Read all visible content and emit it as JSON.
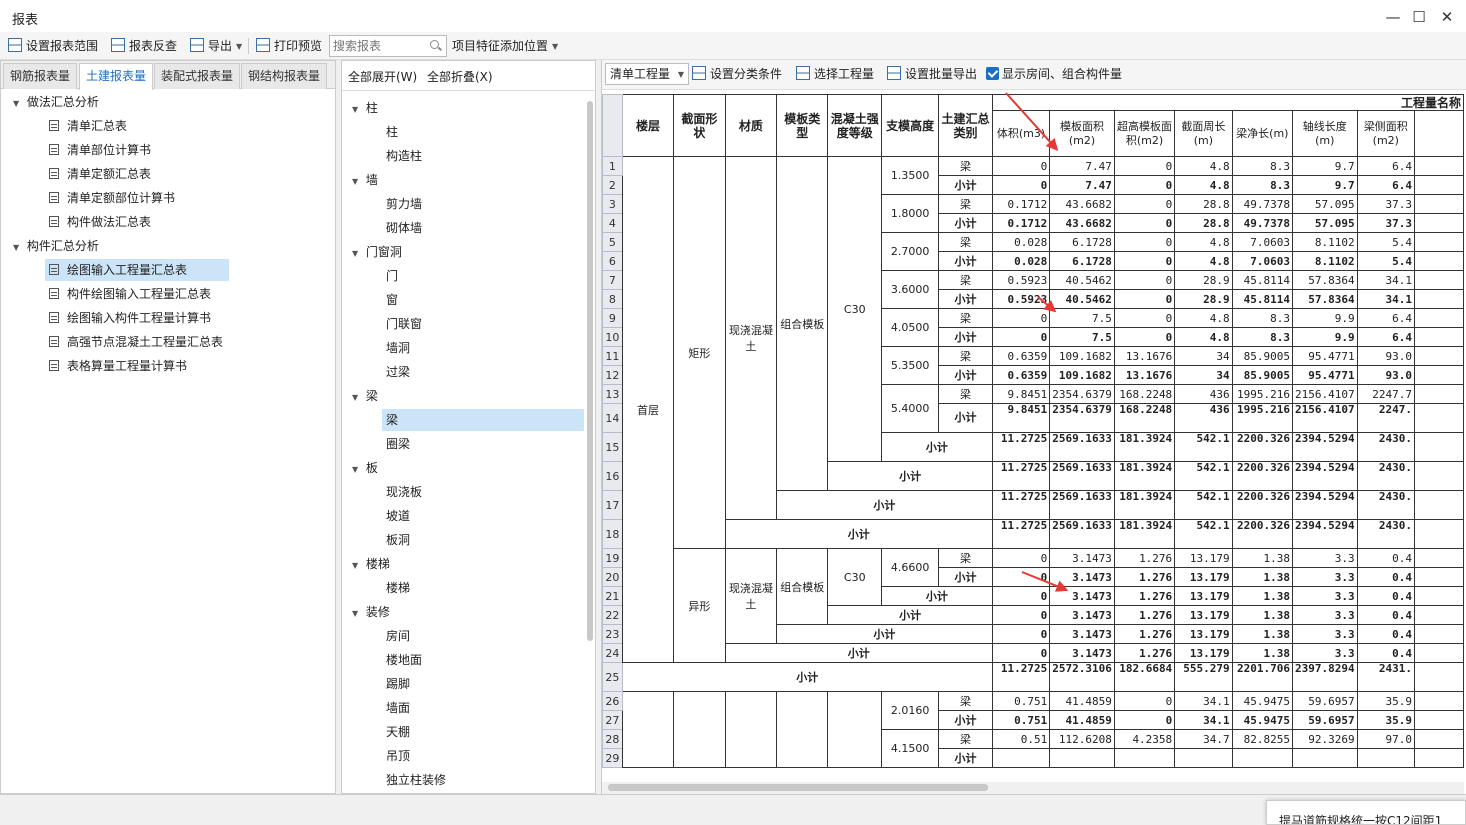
{
  "window": {
    "title": "报表",
    "min": "—",
    "max": "☐",
    "close": "✕"
  },
  "toolbar": {
    "set_range": "设置报表范围",
    "reverse": "报表反查",
    "export": "导出",
    "print_preview": "打印预览",
    "search_placeholder": "搜索报表",
    "feature_position": "项目特征添加位置"
  },
  "tabs": [
    "钢筋报表量",
    "土建报表量",
    "装配式报表量",
    "钢结构报表量"
  ],
  "active_tab": "土建报表量",
  "left_tree": [
    {
      "label": "做法汇总分析",
      "level": 0
    },
    {
      "label": "清单汇总表",
      "level": 1
    },
    {
      "label": "清单部位计算书",
      "level": 1
    },
    {
      "label": "清单定额汇总表",
      "level": 1
    },
    {
      "label": "清单定额部位计算书",
      "level": 1
    },
    {
      "label": "构件做法汇总表",
      "level": 1
    },
    {
      "label": "构件汇总分析",
      "level": 0
    },
    {
      "label": "绘图输入工程量汇总表",
      "level": 1,
      "selected": true
    },
    {
      "label": "构件绘图输入工程量汇总表",
      "level": 1
    },
    {
      "label": "绘图输入构件工程量计算书",
      "level": 1
    },
    {
      "label": "高强节点混凝土工程量汇总表",
      "level": 1
    },
    {
      "label": "表格算量工程量计算书",
      "level": 1
    }
  ],
  "mid_head": {
    "expand_all": "全部展开(W)",
    "collapse_all": "全部折叠(X)"
  },
  "mid_tree": [
    {
      "label": "柱",
      "level": 0
    },
    {
      "label": "柱",
      "level": 1
    },
    {
      "label": "构造柱",
      "level": 1
    },
    {
      "label": "墙",
      "level": 0
    },
    {
      "label": "剪力墙",
      "level": 1
    },
    {
      "label": "砌体墙",
      "level": 1
    },
    {
      "label": "门窗洞",
      "level": 0
    },
    {
      "label": "门",
      "level": 1
    },
    {
      "label": "窗",
      "level": 1
    },
    {
      "label": "门联窗",
      "level": 1
    },
    {
      "label": "墙洞",
      "level": 1
    },
    {
      "label": "过梁",
      "level": 1
    },
    {
      "label": "梁",
      "level": 0
    },
    {
      "label": "梁",
      "level": 1,
      "selected": true
    },
    {
      "label": "圈梁",
      "level": 1
    },
    {
      "label": "板",
      "level": 0
    },
    {
      "label": "现浇板",
      "level": 1
    },
    {
      "label": "坡道",
      "level": 1
    },
    {
      "label": "板洞",
      "level": 1
    },
    {
      "label": "楼梯",
      "level": 0
    },
    {
      "label": "楼梯",
      "level": 1
    },
    {
      "label": "装修",
      "level": 0
    },
    {
      "label": "房间",
      "level": 1
    },
    {
      "label": "楼地面",
      "level": 1
    },
    {
      "label": "踢脚",
      "level": 1
    },
    {
      "label": "墙面",
      "level": 1
    },
    {
      "label": "天棚",
      "level": 1
    },
    {
      "label": "吊顶",
      "level": 1
    },
    {
      "label": "独立柱装修",
      "level": 1
    }
  ],
  "right_toolbar": {
    "combo": "清单工程量",
    "classify": "设置分类条件",
    "select_qty": "选择工程量",
    "batch_export": "设置批量导出",
    "show_rooms": "显示房间、组合构件量"
  },
  "grid": {
    "group_header": "工程量名称",
    "headers": [
      "楼层",
      "截面形状",
      "材质",
      "模板类型",
      "混凝土强度等级",
      "支模高度",
      "土建汇总类别"
    ],
    "qty_headers": [
      "体积(m3)",
      "模板面积(m2)",
      "超高模板面积(m2)",
      "截面周长(m)",
      "梁净长(m)",
      "轴线长度(m)",
      "梁侧面积(m2)"
    ],
    "floor": "首层",
    "shape_rect": "矩形",
    "shape_irregular": "异形",
    "material": "现浇混凝土",
    "formwork": "组合模板",
    "grade": "C30",
    "beam": "梁",
    "subtotal": "小计",
    "heights": [
      "1.3500",
      "1.8000",
      "2.7000",
      "3.6000",
      "4.0500",
      "5.3500",
      "5.4000",
      "4.6600",
      "2.0160",
      "4.1500"
    ],
    "rows": [
      [
        "0",
        "7.47",
        "0",
        "4.8",
        "8.3",
        "9.7",
        "6.4"
      ],
      [
        "0",
        "7.47",
        "0",
        "4.8",
        "8.3",
        "9.7",
        "6.4"
      ],
      [
        "0.1712",
        "43.6682",
        "0",
        "28.8",
        "49.7378",
        "57.095",
        "37.3"
      ],
      [
        "0.1712",
        "43.6682",
        "0",
        "28.8",
        "49.7378",
        "57.095",
        "37.3"
      ],
      [
        "0.028",
        "6.1728",
        "0",
        "4.8",
        "7.0603",
        "8.1102",
        "5.4"
      ],
      [
        "0.028",
        "6.1728",
        "0",
        "4.8",
        "7.0603",
        "8.1102",
        "5.4"
      ],
      [
        "0.5923",
        "40.5462",
        "0",
        "28.9",
        "45.8114",
        "57.8364",
        "34.1"
      ],
      [
        "0.5923",
        "40.5462",
        "0",
        "28.9",
        "45.8114",
        "57.8364",
        "34.1"
      ],
      [
        "0",
        "7.5",
        "0",
        "4.8",
        "8.3",
        "9.9",
        "6.4"
      ],
      [
        "0",
        "7.5",
        "0",
        "4.8",
        "8.3",
        "9.9",
        "6.4"
      ],
      [
        "0.6359",
        "109.1682",
        "13.1676",
        "34",
        "85.9005",
        "95.4771",
        "93.0"
      ],
      [
        "0.6359",
        "109.1682",
        "13.1676",
        "34",
        "85.9005",
        "95.4771",
        "93.0"
      ],
      [
        "9.8451",
        "2354.6379",
        "168.2248",
        "436",
        "1995.216",
        "2156.4107",
        "2247.7"
      ],
      [
        "9.8451",
        "2354.6379",
        "168.2248",
        "436",
        "1995.216",
        "2156.4107",
        "2247."
      ],
      [
        "11.2725",
        "2569.1633",
        "181.3924",
        "542.1",
        "2200.326",
        "2394.5294",
        "2430."
      ],
      [
        "11.2725",
        "2569.1633",
        "181.3924",
        "542.1",
        "2200.326",
        "2394.5294",
        "2430."
      ],
      [
        "11.2725",
        "2569.1633",
        "181.3924",
        "542.1",
        "2200.326",
        "2394.5294",
        "2430."
      ],
      [
        "11.2725",
        "2569.1633",
        "181.3924",
        "542.1",
        "2200.326",
        "2394.5294",
        "2430."
      ],
      [
        "0",
        "3.1473",
        "1.276",
        "13.179",
        "1.38",
        "3.3",
        "0.4"
      ],
      [
        "0",
        "3.1473",
        "1.276",
        "13.179",
        "1.38",
        "3.3",
        "0.4"
      ],
      [
        "0",
        "3.1473",
        "1.276",
        "13.179",
        "1.38",
        "3.3",
        "0.4"
      ],
      [
        "0",
        "3.1473",
        "1.276",
        "13.179",
        "1.38",
        "3.3",
        "0.4"
      ],
      [
        "0",
        "3.1473",
        "1.276",
        "13.179",
        "1.38",
        "3.3",
        "0.4"
      ],
      [
        "0",
        "3.1473",
        "1.276",
        "13.179",
        "1.38",
        "3.3",
        "0.4"
      ],
      [
        "11.2725",
        "2572.3106",
        "182.6684",
        "555.279",
        "2201.706",
        "2397.8294",
        "2431."
      ],
      [
        "0.751",
        "41.4859",
        "0",
        "34.1",
        "45.9475",
        "59.6957",
        "35.9"
      ],
      [
        "0.751",
        "41.4859",
        "0",
        "34.1",
        "45.9475",
        "59.6957",
        "35.9"
      ],
      [
        "0.51",
        "112.6208",
        "4.2358",
        "34.7",
        "82.8255",
        "92.3269",
        "97.0"
      ]
    ]
  },
  "popup_text": "提马道筋规格统一按C12间距1"
}
